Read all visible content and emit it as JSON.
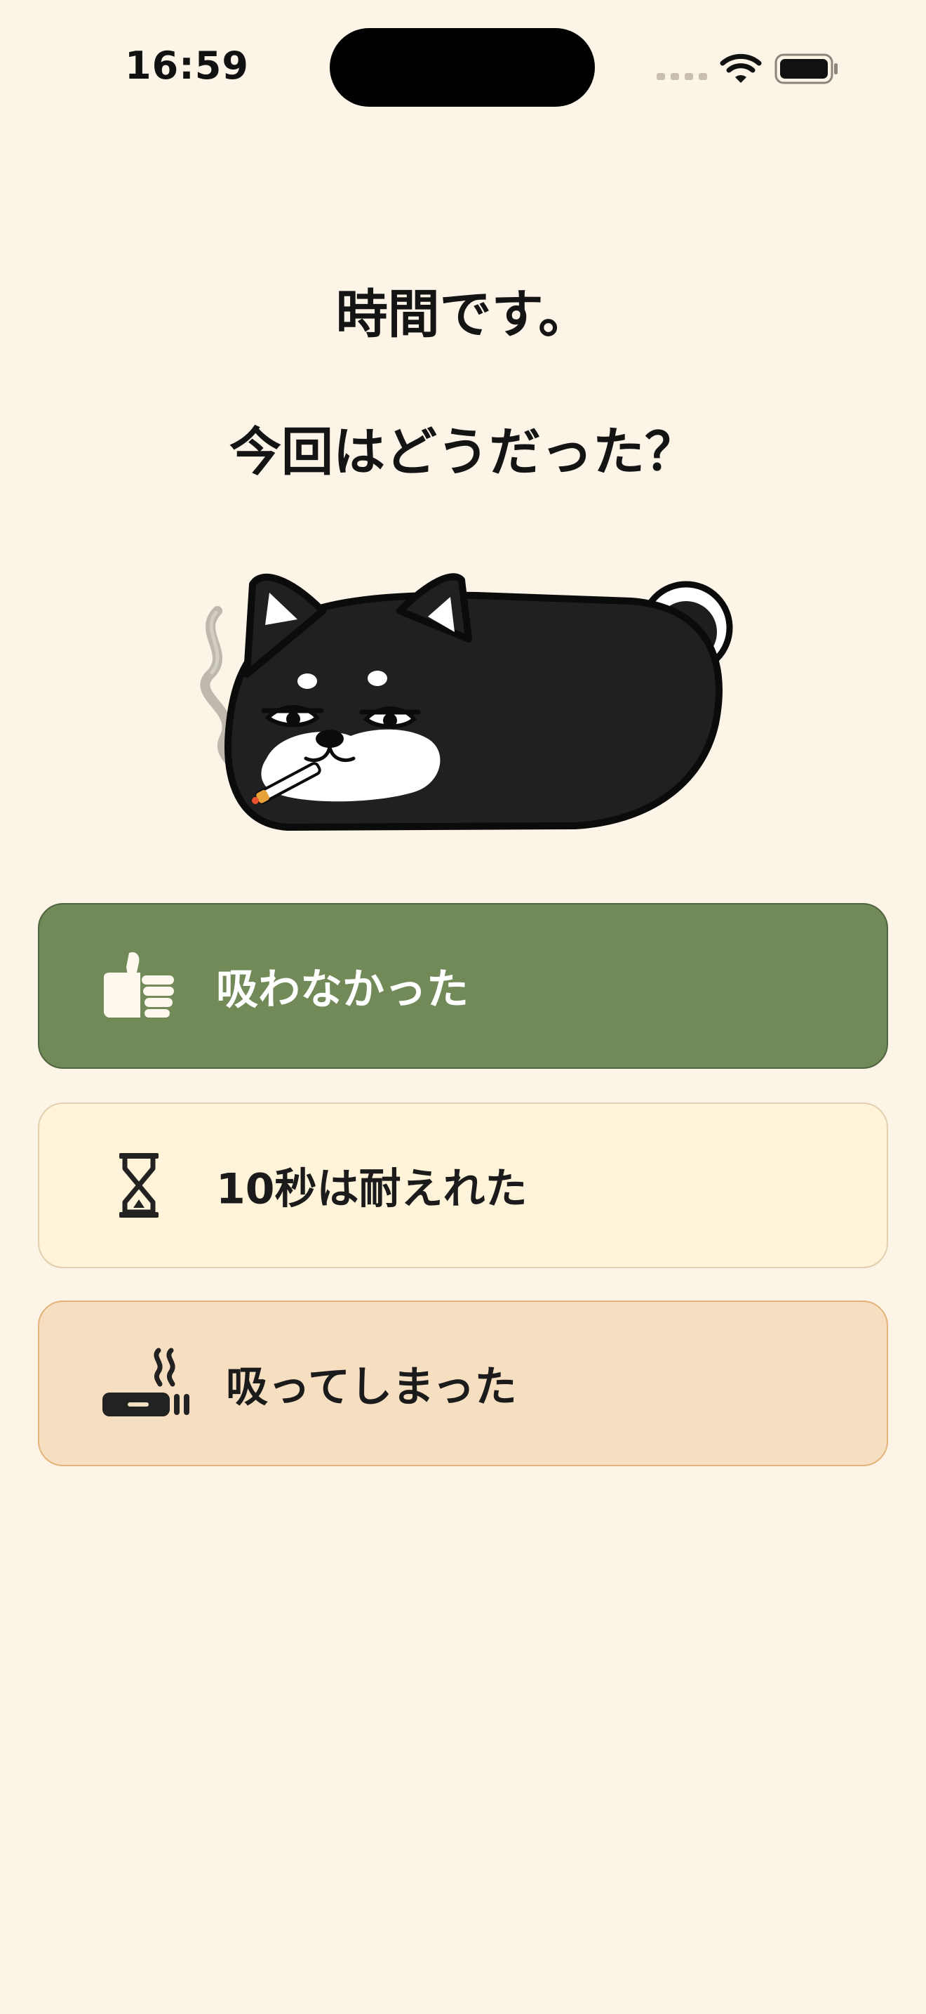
{
  "status_bar": {
    "time": "16:59"
  },
  "prompt": {
    "line1": "時間です。",
    "line2": "今回はどうだった？"
  },
  "mascot": {
    "icon": "smoking-shiba-dog-illustration"
  },
  "options": [
    {
      "label": "吸わなかった",
      "icon": "thumbs-up-icon",
      "background": "#718A58",
      "text_color": "#FFFFFF"
    },
    {
      "label": "10秒は耐えれた",
      "icon": "hourglass-icon",
      "background": "#FFF3D9",
      "text_color": "#1B1B1B"
    },
    {
      "label": "吸ってしまった",
      "icon": "cigarette-icon",
      "background": "#F6DEC0",
      "text_color": "#1B1B1B"
    }
  ]
}
